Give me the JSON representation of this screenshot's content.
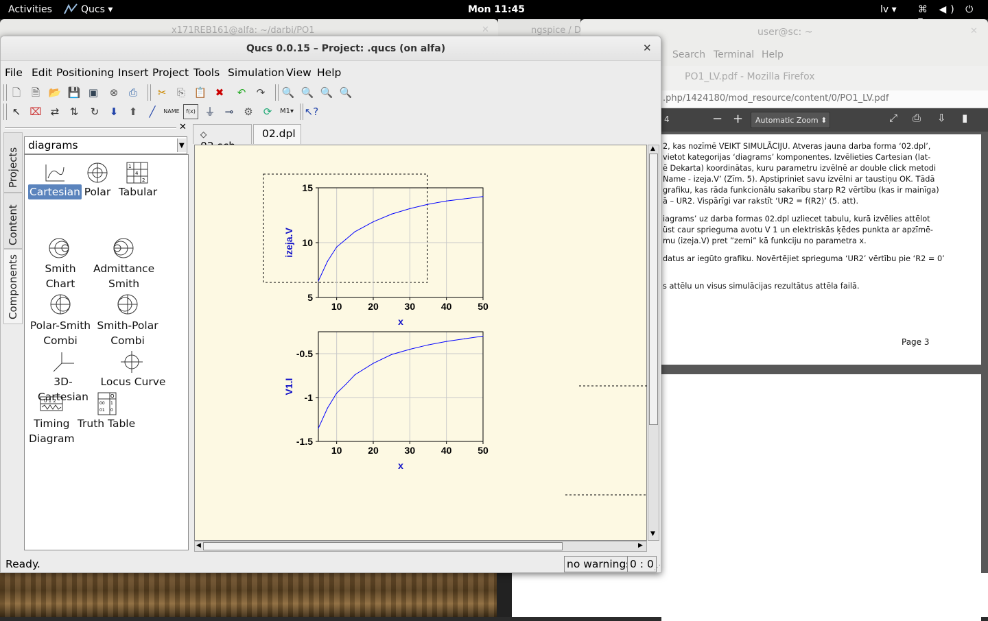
{
  "topbar": {
    "activities": "Activities",
    "app_menu": "Qucs ▾",
    "clock": "Mon 11:45",
    "keyboard": "lv ▾",
    "system_icons": "⌘ ◀) ⏻ ▾"
  },
  "background_windows": {
    "terminal1_title": "x171REB161@alfa: ~/darbi/PO1",
    "ngspice_title": "ngspice / D",
    "terminal2_title": "user@sc: ~",
    "terminal2_menu": [
      "Search",
      "Terminal",
      "Help"
    ]
  },
  "firefox": {
    "title": "PO1_LV.pdf - Mozilla Firefox",
    "url": ".php/1424180/mod_resource/content/0/PO1_LV.pdf",
    "page_number": "4",
    "zoom_label": "Automatic Zoom",
    "paragraphs": [
      "2, kas nozīmē VEIKT SIMULĀCIJU. Atveras jauna darba forma ‘02.dpl’,",
      " vietot kategorijas ‘diagrams’ komponentes. Izvēlieties Cartesian (lat-",
      "ē Dekarta) koordinātas, kuru parametru izvēlnē ar double click metodi",
      "Name - izeja.V’ (Zīm. 5). Apstipriniet savu izvēlni ar taustiņu OK. Tādā",
      " grafiku, kas rāda funkcionālu sakarību starp R2 vērtību (kas ir mainīga)",
      "ā – UR2. Vispārīgi var rakstīt ‘UR2 = f(R2)’ (5. att).",
      "iagrams’ uz darba formas 02.dpl uzliecet tabulu, kurā izvēlies attēlot",
      "üst caur sprieguma avotu V 1 un elektriskās ķēdes punkta ar apzīmē-",
      "mu (izeja.V) pret ”zemi” kā funkciju no parametra x.",
      "datus ar iegūto grafiku. Novērtējiet sprieguma ‘UR2’ vērtību pie ‘R2 = 0’",
      "s attēlu un visus simulācijas rezultātus attēla failā."
    ],
    "page_footer": "Page 3"
  },
  "qucs": {
    "title": "Qucs 0.0.15 – Project: .qucs (on alfa)",
    "menu": {
      "file": "File",
      "edit": "Edit",
      "positioning": "Positioning",
      "insert": "Insert",
      "project": "Project",
      "tools": "Tools",
      "simulation": "Simulation",
      "view": "View",
      "help": "Help"
    },
    "side_tabs": {
      "projects": "Projects",
      "content": "Content",
      "components": "Components"
    },
    "category": "diagrams",
    "components": [
      {
        "label": "Cartesian",
        "icon": "cartesian-icon"
      },
      {
        "label": "Polar",
        "icon": "polar-icon"
      },
      {
        "label": "Tabular",
        "icon": "tabular-icon"
      },
      {
        "label": "Smith Chart",
        "icon": "smith-chart-icon"
      },
      {
        "label": "Admittance Smith",
        "icon": "admittance-smith-icon"
      },
      {
        "label": "Polar-Smith Combi",
        "icon": "polar-smith-icon"
      },
      {
        "label": "Smith-Polar Combi",
        "icon": "smith-polar-icon"
      },
      {
        "label": "3D-Cartesian",
        "icon": "cartesian-3d-icon"
      },
      {
        "label": "Locus Curve",
        "icon": "locus-curve-icon"
      },
      {
        "label": "Timing Diagram",
        "icon": "timing-diagram-icon"
      },
      {
        "label": "Truth Table",
        "icon": "truth-table-icon"
      }
    ],
    "doc_tabs": [
      {
        "label": "02.sch"
      },
      {
        "label": "02.dpl"
      }
    ],
    "status": {
      "ready": "Ready.",
      "warnings": "no warnings",
      "cursor": "0 : 0"
    },
    "colors": {
      "canvas": "#fdf9e3",
      "curve": "#0000ff",
      "axis_label": "#1010c8",
      "selection": "#5b84bd"
    }
  },
  "chart_data": [
    {
      "type": "line",
      "xlabel": "x",
      "ylabel": "izeja.V",
      "xlim": [
        5,
        50
      ],
      "ylim": [
        5,
        15
      ],
      "xticks": [
        10,
        20,
        30,
        40,
        50
      ],
      "yticks": [
        5,
        10,
        15
      ],
      "grid": true,
      "series": [
        {
          "x": [
            5,
            7.5,
            10,
            12.5,
            15,
            20,
            25,
            30,
            35,
            40,
            45,
            50
          ],
          "y": [
            6.5,
            8.3,
            9.6,
            10.3,
            11.0,
            11.9,
            12.6,
            13.1,
            13.5,
            13.8,
            14.0,
            14.2
          ]
        }
      ]
    },
    {
      "type": "line",
      "xlabel": "x",
      "ylabel": "V1.I",
      "xlim": [
        5,
        50
      ],
      "ylim": [
        -1.5,
        -0.25
      ],
      "xticks": [
        10,
        20,
        30,
        40,
        50
      ],
      "yticks": [
        -1.5,
        -1,
        -0.5
      ],
      "ytick_labels": [
        "-1.5",
        "-1",
        "-0.5"
      ],
      "grid": true,
      "series": [
        {
          "x": [
            5,
            7.5,
            10,
            12.5,
            15,
            20,
            25,
            30,
            35,
            40,
            45,
            50
          ],
          "y": [
            -1.35,
            -1.12,
            -0.95,
            -0.85,
            -0.74,
            -0.61,
            -0.51,
            -0.45,
            -0.4,
            -0.36,
            -0.33,
            -0.3
          ]
        }
      ]
    }
  ]
}
